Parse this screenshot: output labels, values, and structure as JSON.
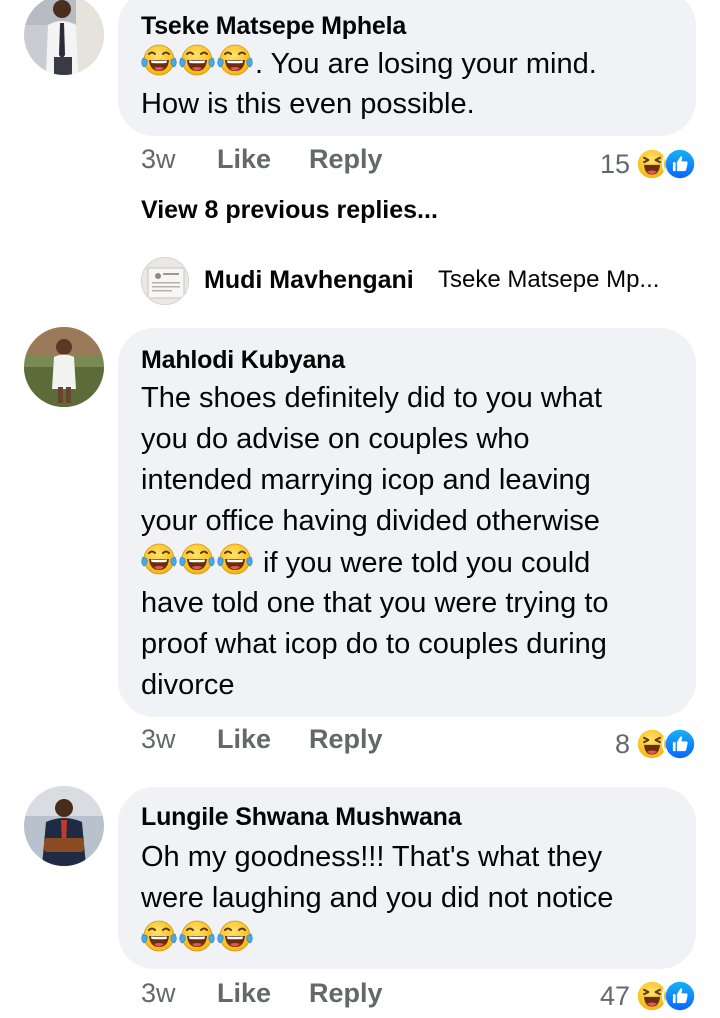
{
  "comments": [
    {
      "author": "Tseke Matsepe Mphela",
      "lines": [
        {
          "emoji": 3,
          "text": ". You are losing your mind."
        },
        {
          "emoji": 0,
          "text": "How is this even possible."
        }
      ],
      "time": "3w",
      "like_label": "Like",
      "reply_label": "Reply",
      "reaction_count": "15"
    },
    {
      "author": "Mahlodi Kubyana",
      "lines": [
        {
          "emoji": 0,
          "text": "The shoes definitely did to you what"
        },
        {
          "emoji": 0,
          "text": "you do advise on couples who"
        },
        {
          "emoji": 0,
          "text": "intended marrying icop and leaving"
        },
        {
          "emoji": 0,
          "text": "your office having divided otherwise"
        },
        {
          "emoji": 3,
          "text": " if you were told you could"
        },
        {
          "emoji": 0,
          "text": "have told one that you were trying to"
        },
        {
          "emoji": 0,
          "text": "proof what icop do to couples during"
        },
        {
          "emoji": 0,
          "text": "divorce"
        }
      ],
      "time": "3w",
      "like_label": "Like",
      "reply_label": "Reply",
      "reaction_count": "8"
    },
    {
      "author": "Lungile Shwana Mushwana",
      "lines": [
        {
          "emoji": 0,
          "text": "Oh my goodness!!! That's what they"
        },
        {
          "emoji": 0,
          "text": "were laughing and you did not notice"
        },
        {
          "emoji": 3,
          "text": ""
        }
      ],
      "time": "3w",
      "like_label": "Like",
      "reply_label": "Reply",
      "reaction_count": "47"
    }
  ],
  "replies_thread": {
    "view_previous_label": "View 8 previous replies...",
    "reply_author": "Mudi Mavhengani",
    "reply_snippet": "Tseke Matsepe Mp..."
  },
  "icons": {
    "emoji": "laughing-tears-emoji",
    "reaction_haha": "haha-reaction-icon",
    "reaction_like": "like-reaction-icon"
  },
  "colors": {
    "bubble": "#f0f2f5",
    "meta_text": "#65676b",
    "like_blue": "#1877f2",
    "haha_yellow": "#f7c33b"
  }
}
